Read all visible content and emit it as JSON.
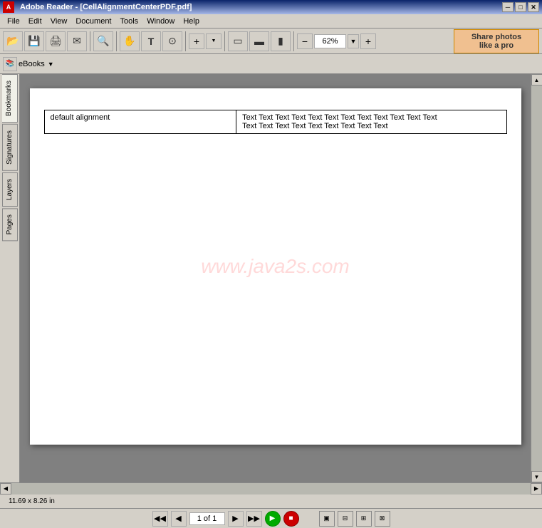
{
  "titlebar": {
    "title": "Adobe Reader - [CellAlignmentCenterPDF.pdf]",
    "logo": "A",
    "min_btn": "─",
    "max_btn": "□",
    "close_btn": "✕",
    "inner_min": "─",
    "inner_max": "□",
    "inner_close": "✕"
  },
  "menubar": {
    "items": [
      "File",
      "Edit",
      "View",
      "Document",
      "Tools",
      "Window",
      "Help"
    ]
  },
  "toolbar1": {
    "buttons": [
      {
        "name": "open-folder-btn",
        "icon": "📂"
      },
      {
        "name": "save-btn",
        "icon": "💾"
      },
      {
        "name": "print-btn",
        "icon": "🖨"
      },
      {
        "name": "email-btn",
        "icon": "✉"
      },
      {
        "name": "search-btn",
        "icon": "🔍"
      },
      {
        "name": "hand-btn",
        "icon": "✋"
      },
      {
        "name": "select-btn",
        "icon": "T"
      },
      {
        "name": "snapshot-btn",
        "icon": "⊙"
      },
      {
        "name": "zoom-in-btn",
        "icon": "+"
      },
      {
        "name": "fit-page-btn",
        "icon": "▭"
      },
      {
        "name": "fit-width-btn",
        "icon": "▬"
      },
      {
        "name": "fit-height-btn",
        "icon": "▮"
      },
      {
        "name": "zoom-out-btn",
        "icon": "−"
      }
    ],
    "zoom_value": "62%",
    "zoom_placeholder": "62%"
  },
  "share_banner": {
    "line1": "Share photos",
    "line2": "like a pro"
  },
  "toolbar2": {
    "ebooks_label": "eBooks",
    "dropdown_icon": "▼"
  },
  "side_tabs": [
    {
      "name": "bookmarks-tab",
      "label": "Bookmarks"
    },
    {
      "name": "signatures-tab",
      "label": "Signatures"
    },
    {
      "name": "layers-tab",
      "label": "Layers"
    },
    {
      "name": "pages-tab",
      "label": "Pages"
    }
  ],
  "pdf": {
    "table": {
      "cell1": "default alignment",
      "cell2": "Text Text Text Text Text Text Text Text Text Text Text Text Text Text Text Text Text Text Text"
    },
    "watermark": "www.java2s.com"
  },
  "statusbar": {
    "size_label": "11.69 x 8.26 in"
  },
  "navbar": {
    "first_btn": "◀◀",
    "prev_btn": "◀",
    "page_value": "1 of 1",
    "next_btn": "▶",
    "last_btn": "▶▶",
    "play_btn": "▶",
    "end_btns": [
      "◧",
      "◨",
      "◩"
    ]
  }
}
